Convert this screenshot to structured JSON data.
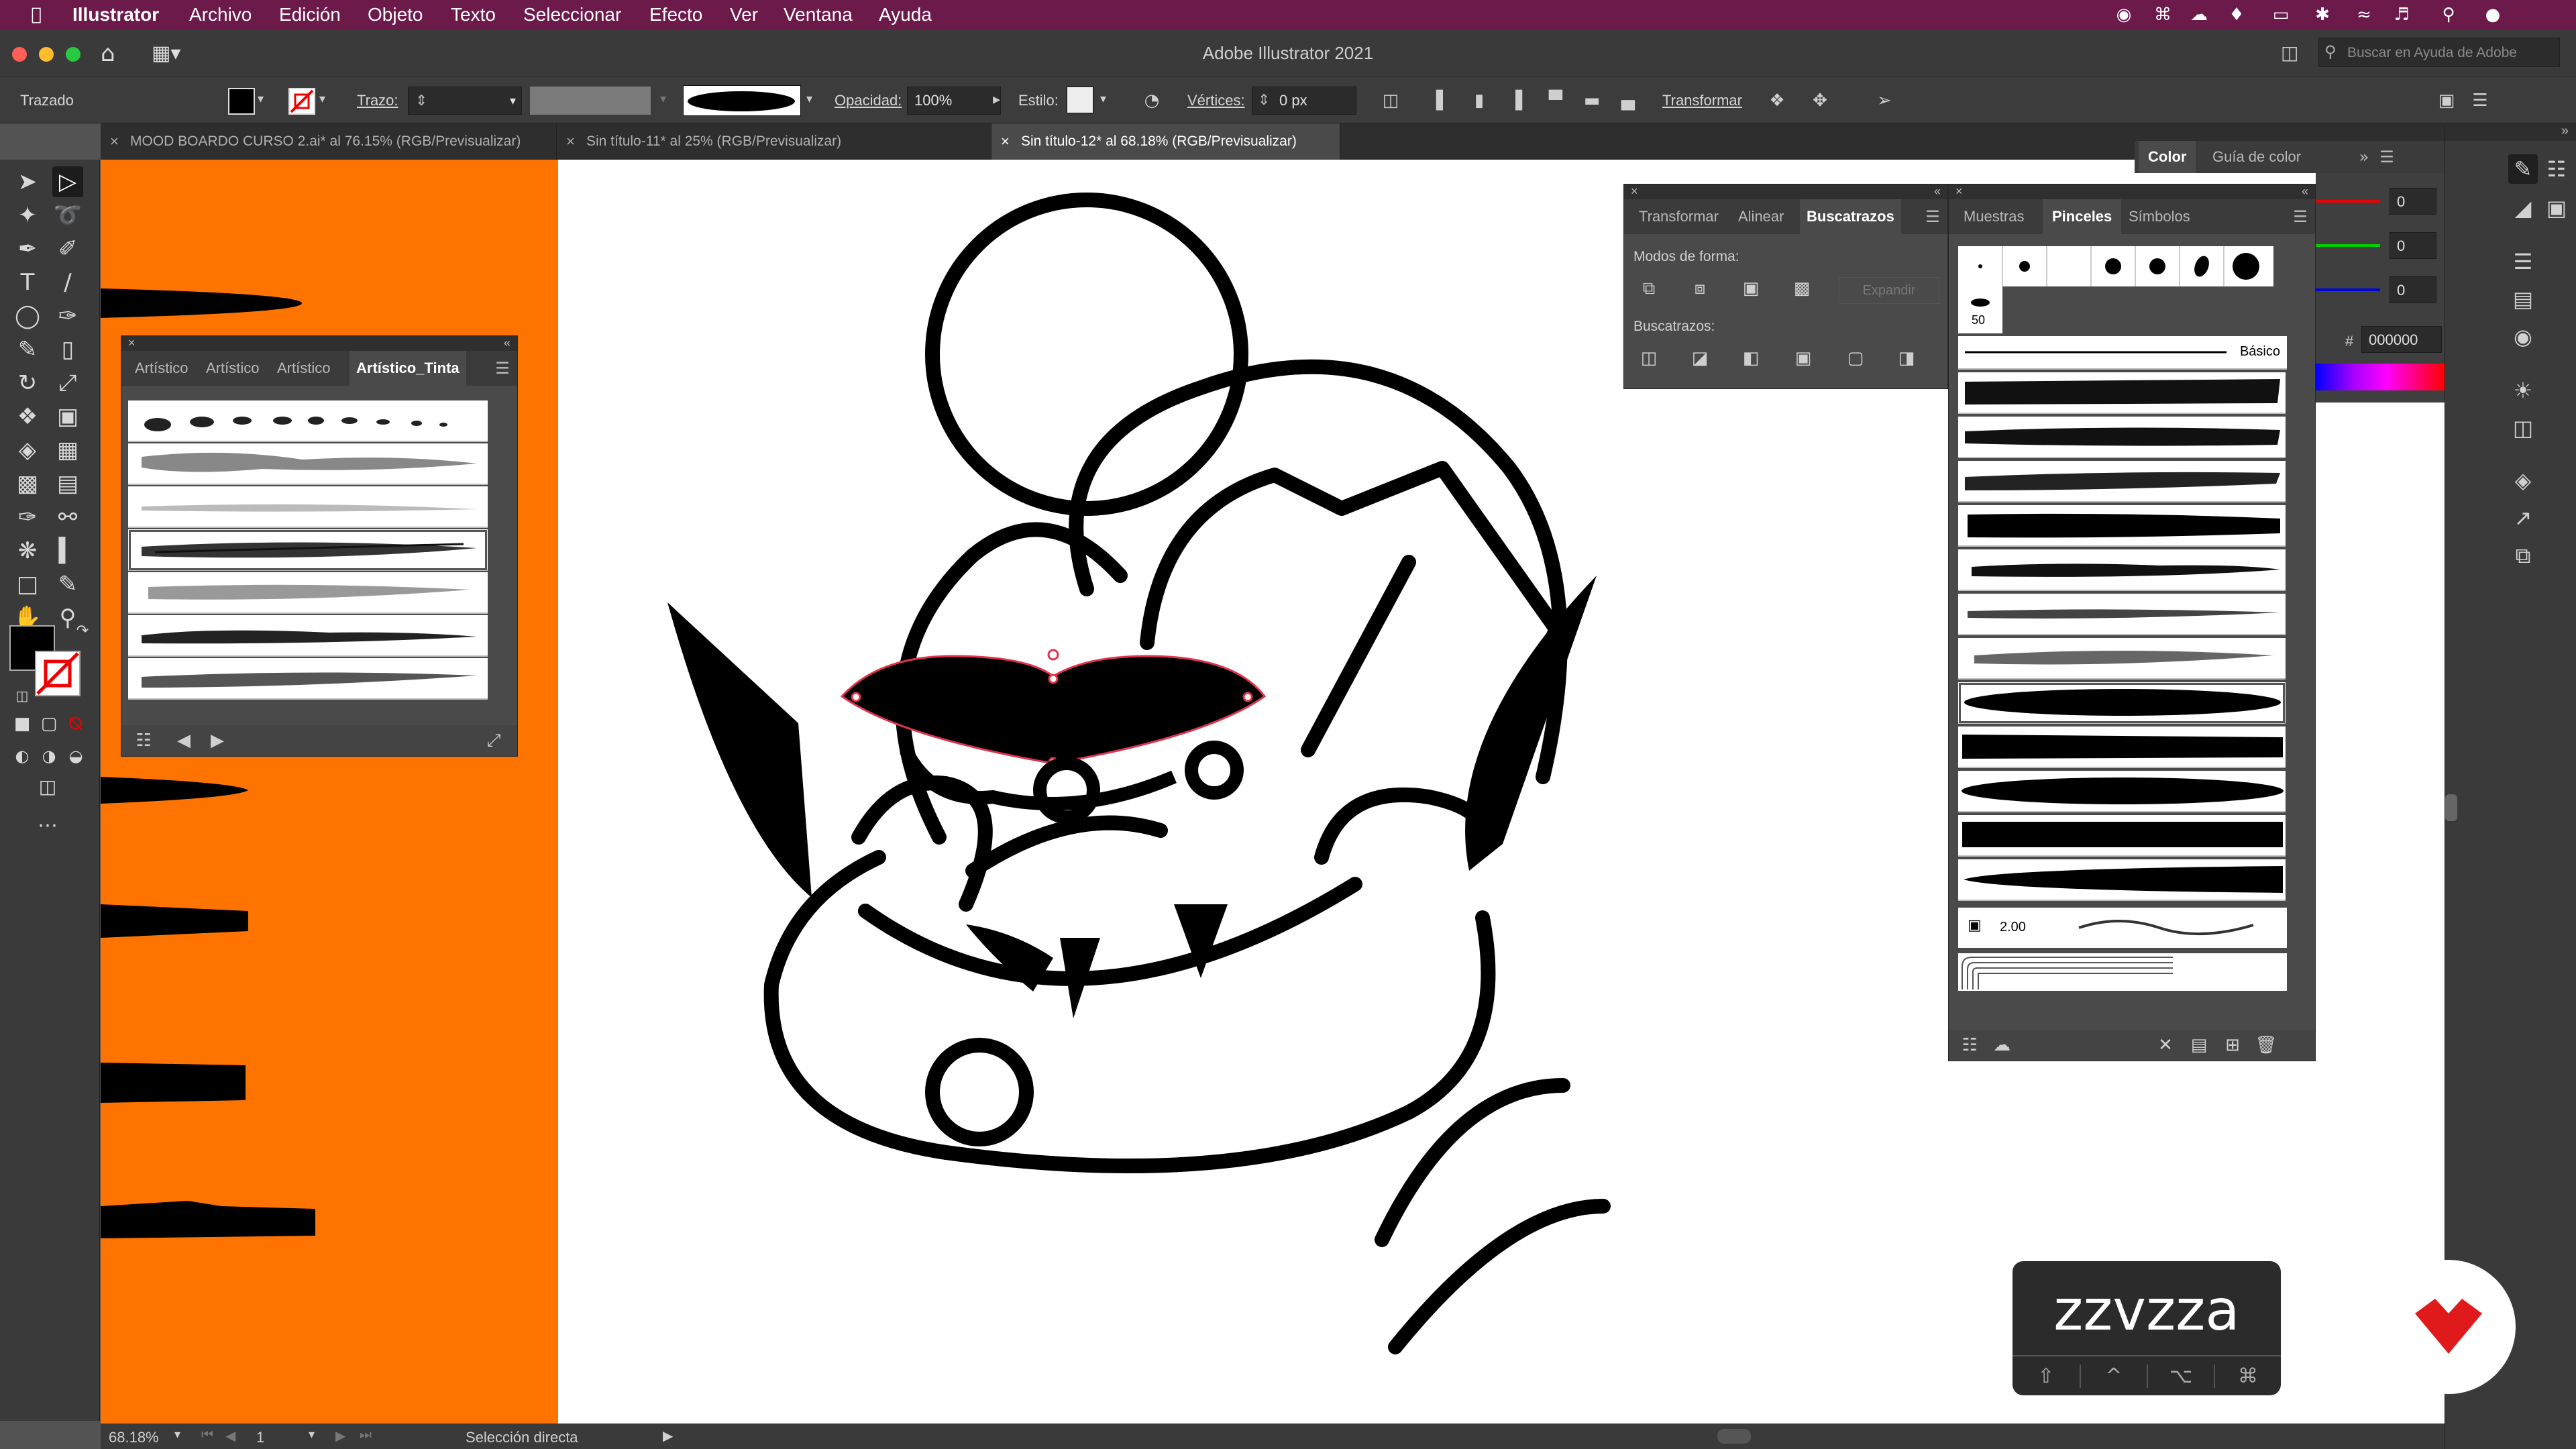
{
  "menubar": {
    "app": "Illustrator",
    "items": [
      "Archivo",
      "Edición",
      "Objeto",
      "Texto",
      "Seleccionar",
      "Efecto",
      "Ver",
      "Ventana",
      "Ayuda"
    ]
  },
  "window": {
    "title": "Adobe Illustrator 2021",
    "search_placeholder": "Buscar en Ayuda de Adobe"
  },
  "control": {
    "selection_type": "Trazado",
    "stroke_label": "Trazo:",
    "opacity_label": "Opacidad:",
    "opacity_value": "100%",
    "style_label": "Estilo:",
    "vertices_label": "Vértices:",
    "vertices_value": "0 px",
    "transform_label": "Transformar"
  },
  "tabs": [
    {
      "label": "MOOD BOARDO CURSO 2.ai* al 76.15% (RGB/Previsualizar)"
    },
    {
      "label": "Sin título-11* al 25% (RGB/Previsualizar)"
    },
    {
      "label": "Sin título-12* al 68.18% (RGB/Previsualizar)"
    }
  ],
  "art_brush_panel": {
    "tabs": [
      "Artístico",
      "Artístico",
      "Artístico",
      "Artístico_Tinta"
    ]
  },
  "pathfinder_panel": {
    "tabs": [
      "Transformar",
      "Alinear",
      "Buscatrazos"
    ],
    "shape_modes_label": "Modos de forma:",
    "expand_label": "Expandir",
    "pathfinders_label": "Buscatrazos:"
  },
  "brushes_panel": {
    "tabs": [
      "Muestras",
      "Pinceles",
      "Símbolos"
    ],
    "size_value": "50",
    "basic_label": "Básico",
    "pattern_value": "2.00"
  },
  "color_panel": {
    "tabs": [
      "Color",
      "Guía de color"
    ],
    "r": "0",
    "g": "0",
    "b": "0",
    "hex_prefix": "#",
    "hex": "000000"
  },
  "status": {
    "zoom": "68.18%",
    "artboard": "1",
    "tool": "Selección directa"
  },
  "keycast": {
    "text": "zzvzza",
    "keys": [
      "⇧",
      "^",
      "⌥",
      "⌘"
    ]
  },
  "colors": {
    "menubar": "#6b1a4a",
    "accent_orange": "#ff7300",
    "logo_red": "#e01a1a"
  }
}
